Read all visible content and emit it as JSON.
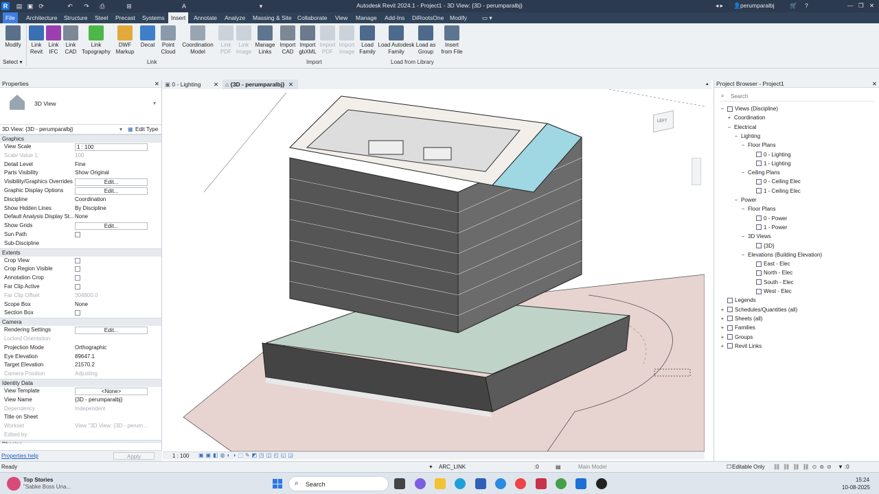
{
  "titlebar": {
    "title": "Autodesk Revit 2024.1 - Project1 - 3D View: {3D - perumparalbj}",
    "user": "perumparalbj"
  },
  "menu": {
    "tabs": [
      "File",
      "Architecture",
      "Structure",
      "Steel",
      "Precast",
      "Systems",
      "Insert",
      "Annotate",
      "Analyze",
      "Massing & Site",
      "Collaborate",
      "View",
      "Manage",
      "Add-Ins",
      "DiRootsOne",
      "Modify"
    ],
    "active": "Insert"
  },
  "ribbon": {
    "buttons": [
      {
        "label": "Modify",
        "enabled": true
      },
      {
        "label": "Link Revit",
        "enabled": true
      },
      {
        "label": "Link IFC",
        "enabled": true
      },
      {
        "label": "Link CAD",
        "enabled": true
      },
      {
        "label": "Link Topography",
        "enabled": true
      },
      {
        "label": "DWF Markup",
        "enabled": true
      },
      {
        "label": "Decal",
        "enabled": true
      },
      {
        "label": "Point Cloud",
        "enabled": true
      },
      {
        "label": "Coordination Model",
        "enabled": true
      },
      {
        "label": "Link PDF",
        "enabled": false
      },
      {
        "label": "Link Image",
        "enabled": false
      },
      {
        "label": "Manage Links",
        "enabled": true
      },
      {
        "label": "Import CAD",
        "enabled": true
      },
      {
        "label": "Import gbXML",
        "enabled": true
      },
      {
        "label": "Import PDF",
        "enabled": false
      },
      {
        "label": "Import Image",
        "enabled": false
      },
      {
        "label": "Load Family",
        "enabled": true
      },
      {
        "label": "Load Autodesk Family",
        "enabled": true
      },
      {
        "label": "Load as Group",
        "enabled": true
      },
      {
        "label": "Insert from File",
        "enabled": true
      }
    ],
    "groups": {
      "select": "Select",
      "link": "Link",
      "import": "Import",
      "load": "Load from Library"
    }
  },
  "properties": {
    "header": "Properties",
    "type_name": "3D View",
    "instance_selector": "3D View: {3D - perumparalbj}",
    "edit_type": "Edit Type",
    "sections": [
      {
        "title": "Graphics",
        "rows": [
          {
            "k": "View Scale",
            "v": "1 : 100",
            "kind": "input"
          },
          {
            "k": "Scale Value    1:",
            "v": "100",
            "kind": "dim"
          },
          {
            "k": "Detail Level",
            "v": "Fine",
            "kind": "text"
          },
          {
            "k": "Parts Visibility",
            "v": "Show Original",
            "kind": "text"
          },
          {
            "k": "Visibility/Graphics Overrides",
            "v": "Edit...",
            "kind": "button"
          },
          {
            "k": "Graphic Display Options",
            "v": "Edit...",
            "kind": "button"
          },
          {
            "k": "Discipline",
            "v": "Coordination",
            "kind": "text"
          },
          {
            "k": "Show Hidden Lines",
            "v": "By Discipline",
            "kind": "text"
          },
          {
            "k": "Default Analysis Display St...",
            "v": "None",
            "kind": "text"
          },
          {
            "k": "Show Grids",
            "v": "Edit...",
            "kind": "button"
          },
          {
            "k": "Sun Path",
            "v": "",
            "kind": "check"
          },
          {
            "k": "Sub-Discipline",
            "v": "",
            "kind": "text"
          }
        ]
      },
      {
        "title": "Extents",
        "rows": [
          {
            "k": "Crop View",
            "v": "",
            "kind": "check"
          },
          {
            "k": "Crop Region Visible",
            "v": "",
            "kind": "check"
          },
          {
            "k": "Annotation Crop",
            "v": "",
            "kind": "check"
          },
          {
            "k": "Far Clip Active",
            "v": "",
            "kind": "check"
          },
          {
            "k": "Far Clip Offset",
            "v": "304800.0",
            "kind": "dim"
          },
          {
            "k": "Scope Box",
            "v": "None",
            "kind": "text"
          },
          {
            "k": "Section Box",
            "v": "",
            "kind": "check"
          }
        ]
      },
      {
        "title": "Camera",
        "rows": [
          {
            "k": "Rendering Settings",
            "v": "Edit...",
            "kind": "button"
          },
          {
            "k": "Locked Orientation",
            "v": "",
            "kind": "dim"
          },
          {
            "k": "Projection Mode",
            "v": "Orthographic",
            "kind": "text"
          },
          {
            "k": "Eye Elevation",
            "v": "89647.1",
            "kind": "text"
          },
          {
            "k": "Target Elevation",
            "v": "21570.2",
            "kind": "text"
          },
          {
            "k": "Camera Position",
            "v": "Adjusting",
            "kind": "dim"
          }
        ]
      },
      {
        "title": "Identity Data",
        "rows": [
          {
            "k": "View Template",
            "v": "<None>",
            "kind": "button"
          },
          {
            "k": "View Name",
            "v": "{3D - perumparalbj}",
            "kind": "text"
          },
          {
            "k": "Dependency",
            "v": "Independent",
            "kind": "dim"
          },
          {
            "k": "Title on Sheet",
            "v": "",
            "kind": "text"
          },
          {
            "k": "Workset",
            "v": "View \"3D View: {3D - perum...",
            "kind": "dim"
          },
          {
            "k": "Edited by",
            "v": "",
            "kind": "dim"
          }
        ]
      },
      {
        "title": "Phasing",
        "rows": []
      }
    ],
    "help": "Properties help",
    "apply": "Apply"
  },
  "view_tabs": [
    {
      "label": "0 - Lighting",
      "active": false
    },
    {
      "label": "{3D - perumparalbj}",
      "active": true
    }
  ],
  "viewcube_label": "LEFT",
  "view_scale": "1 : 100",
  "browser": {
    "header": "Project Browser - Project1",
    "search_placeholder": "Search",
    "nodes": [
      {
        "label": "Views (Discipline)",
        "lvl": 0,
        "tg": "−"
      },
      {
        "label": "Coordination",
        "lvl": 1,
        "tg": "+"
      },
      {
        "label": "Electrical",
        "lvl": 1,
        "tg": "−"
      },
      {
        "label": "Lighting",
        "lvl": 2,
        "tg": "−"
      },
      {
        "label": "Floor Plans",
        "lvl": 3,
        "tg": "−"
      },
      {
        "label": "0 - Lighting",
        "lvl": 4,
        "tg": ""
      },
      {
        "label": "1 - Lighting",
        "lvl": 4,
        "tg": ""
      },
      {
        "label": "Ceiling Plans",
        "lvl": 3,
        "tg": "−"
      },
      {
        "label": "0 - Ceiling Elec",
        "lvl": 4,
        "tg": ""
      },
      {
        "label": "1 - Ceiling Elec",
        "lvl": 4,
        "tg": ""
      },
      {
        "label": "Power",
        "lvl": 2,
        "tg": "−"
      },
      {
        "label": "Floor Plans",
        "lvl": 3,
        "tg": "−"
      },
      {
        "label": "0 - Power",
        "lvl": 4,
        "tg": ""
      },
      {
        "label": "1 - Power",
        "lvl": 4,
        "tg": ""
      },
      {
        "label": "3D Views",
        "lvl": 3,
        "tg": "−"
      },
      {
        "label": "{3D}",
        "lvl": 4,
        "tg": ""
      },
      {
        "label": "Elevations (Building Elevation)",
        "lvl": 3,
        "tg": "−"
      },
      {
        "label": "East - Elec",
        "lvl": 4,
        "tg": ""
      },
      {
        "label": "North - Elec",
        "lvl": 4,
        "tg": ""
      },
      {
        "label": "South - Elec",
        "lvl": 4,
        "tg": ""
      },
      {
        "label": "West - Elec",
        "lvl": 4,
        "tg": ""
      },
      {
        "label": "Legends",
        "lvl": 0,
        "tg": ""
      },
      {
        "label": "Schedules/Quantities (all)",
        "lvl": 0,
        "tg": "+"
      },
      {
        "label": "Sheets (all)",
        "lvl": 0,
        "tg": "+"
      },
      {
        "label": "Families",
        "lvl": 0,
        "tg": "+"
      },
      {
        "label": "Groups",
        "lvl": 0,
        "tg": "+"
      },
      {
        "label": "Revit Links",
        "lvl": 0,
        "tg": "+"
      }
    ]
  },
  "status": {
    "left": "Ready",
    "workset": "ARC_LINK",
    "count": ":0",
    "model": "Main Model",
    "editable": "Editable Only",
    "filter": ":0"
  },
  "taskbar": {
    "news_title": "Top Stories",
    "news_sub": "\"Sabke Boss Una...",
    "search": "Search",
    "time": "15:24",
    "date": "10-08-2025"
  }
}
